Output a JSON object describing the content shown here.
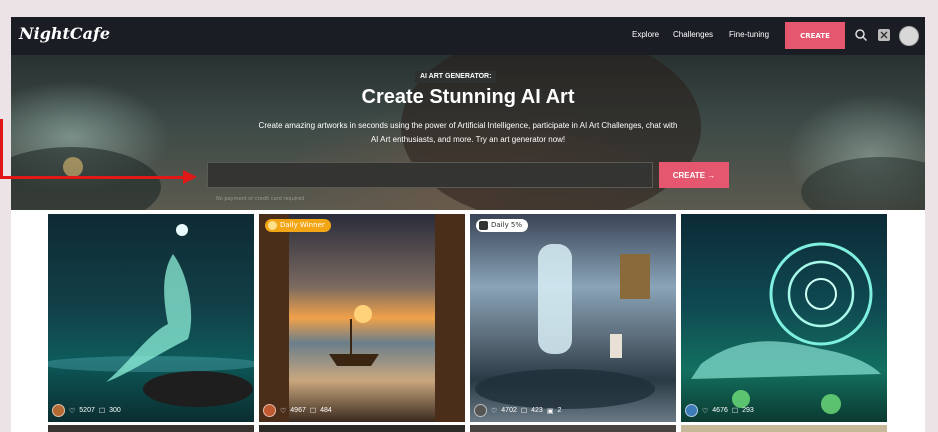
{
  "nav": {
    "logo": "NightCafe",
    "links": [
      "Explore",
      "Challenges",
      "Fine-tuning"
    ],
    "create": "CREATE"
  },
  "hero": {
    "eyebrow": "AI ART GENERATOR:",
    "title": "Create Stunning AI Art",
    "subtitle": "Create amazing artworks in seconds using the power of Artificial Intelligence, participate in AI Art Challenges, chat with AI Art enthusiasts, and more. Try an art generator now!",
    "prompt_value": "",
    "create": "CREATE →",
    "hint": "No payment or credit card required"
  },
  "cards": [
    {
      "badge": "",
      "likes": "5207",
      "comments": "300",
      "extra": ""
    },
    {
      "badge": "Daily Winner",
      "likes": "4967",
      "comments": "484",
      "extra": ""
    },
    {
      "badge": "Daily 5%",
      "likes": "4702",
      "comments": "423",
      "extra": "2"
    },
    {
      "badge": "",
      "likes": "4676",
      "comments": "293",
      "extra": ""
    }
  ],
  "colors": {
    "accent": "#e5566f",
    "nav": "#1a1d24",
    "annotation": "#e01818"
  },
  "icons": [
    "search-icon",
    "grid-icon",
    "heart-icon",
    "comment-icon",
    "trophy-icon",
    "image-icon"
  ]
}
